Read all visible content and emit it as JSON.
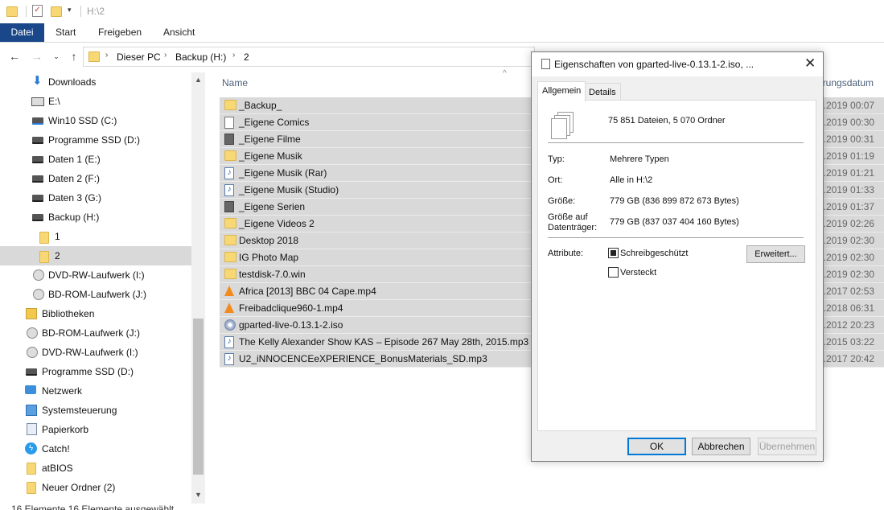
{
  "window": {
    "title_path": "H:\\2"
  },
  "ribbon": {
    "tabs": [
      "Datei",
      "Start",
      "Freigeben",
      "Ansicht"
    ]
  },
  "address": {
    "crumbs": [
      "Dieser PC",
      "Backup (H:)",
      "2"
    ]
  },
  "nav": {
    "items": [
      {
        "label": "Downloads",
        "icon": "download-arrow-icon"
      },
      {
        "label": "E:\\",
        "icon": "drive-icon"
      },
      {
        "label": "Win10 SSD (C:)",
        "icon": "windows-drive-icon"
      },
      {
        "label": "Programme SSD (D:)",
        "icon": "drive-icon"
      },
      {
        "label": "Daten 1 (E:)",
        "icon": "drive-icon"
      },
      {
        "label": "Daten 2 (F:)",
        "icon": "drive-icon"
      },
      {
        "label": "Daten 3 (G:)",
        "icon": "drive-icon"
      },
      {
        "label": "Backup (H:)",
        "icon": "drive-icon"
      },
      {
        "label": "1",
        "icon": "folder-icon"
      },
      {
        "label": "2",
        "icon": "folder-icon"
      },
      {
        "label": "DVD-RW-Laufwerk (I:)",
        "icon": "optical-drive-icon"
      },
      {
        "label": "BD-ROM-Laufwerk (J:)",
        "icon": "optical-drive-icon"
      },
      {
        "label": "Bibliotheken",
        "icon": "libraries-icon"
      },
      {
        "label": "BD-ROM-Laufwerk (J:)",
        "icon": "optical-drive-icon"
      },
      {
        "label": "DVD-RW-Laufwerk (I:)",
        "icon": "optical-drive-icon"
      },
      {
        "label": "Programme SSD (D:)",
        "icon": "drive-icon"
      },
      {
        "label": "Netzwerk",
        "icon": "network-icon"
      },
      {
        "label": "Systemsteuerung",
        "icon": "control-panel-icon"
      },
      {
        "label": "Papierkorb",
        "icon": "recycle-bin-icon"
      },
      {
        "label": "Catch!",
        "icon": "catch-app-icon"
      },
      {
        "label": "atBIOS",
        "icon": "folder-icon"
      },
      {
        "label": "Neuer Ordner (2)",
        "icon": "folder-icon"
      }
    ]
  },
  "list": {
    "header": {
      "name": "Name",
      "date": "erungsdatum"
    },
    "rows": [
      {
        "name": "_Backup_",
        "icon": "folder-icon",
        "date": "2.2019 00:07"
      },
      {
        "name": "_Eigene Comics",
        "icon": "document-icon",
        "date": "2.2019 00:30"
      },
      {
        "name": "_Eigene Filme",
        "icon": "film-icon",
        "date": "2.2019 00:31"
      },
      {
        "name": "_Eigene Musik",
        "icon": "folder-icon",
        "date": "2.2019 01:19"
      },
      {
        "name": "_Eigene Musik (Rar)",
        "icon": "music-icon",
        "date": "2.2019 01:21"
      },
      {
        "name": "_Eigene Musik (Studio)",
        "icon": "music-icon",
        "date": "2.2019 01:33"
      },
      {
        "name": "_Eigene Serien",
        "icon": "film-icon",
        "date": "2.2019 01:37"
      },
      {
        "name": "_Eigene Videos 2",
        "icon": "folder-icon",
        "date": "2.2019 02:26"
      },
      {
        "name": "Desktop 2018",
        "icon": "folder-icon",
        "date": "2.2019 02:30"
      },
      {
        "name": "IG Photo Map",
        "icon": "folder-icon",
        "date": "2.2019 02:30"
      },
      {
        "name": "testdisk-7.0.win",
        "icon": "folder-icon",
        "date": "2.2019 02:30"
      },
      {
        "name": "Africa [2013] BBC 04 Cape.mp4",
        "icon": "vlc-icon",
        "date": "5.2017 02:53"
      },
      {
        "name": "Freibadclique960-1.mp4",
        "icon": "vlc-icon",
        "date": "4.2018 06:31"
      },
      {
        "name": "gparted-live-0.13.1-2.iso",
        "icon": "disc-image-icon",
        "date": "8.2012 20:23"
      },
      {
        "name": "The Kelly Alexander Show KAS – Episode 267 May 28th, 2015.mp3",
        "icon": "music-icon",
        "date": "5.2015 03:22"
      },
      {
        "name": "U2_iNNOCENCEeXPERIENCE_BonusMaterials_SD.mp3",
        "icon": "music-icon",
        "date": "1.2017 20:42"
      }
    ]
  },
  "dialog": {
    "title": "Eigenschaften von gparted-live-0.13.1-2.iso, ...",
    "tabs": [
      "Allgemein",
      "Details"
    ],
    "summary": "75 851 Dateien, 5 070 Ordner",
    "type_label": "Typ:",
    "type_value": "Mehrere Typen",
    "location_label": "Ort:",
    "location_value": "Alle in H:\\2",
    "size_label": "Größe:",
    "size_value": "779 GB (836 899 872 673 Bytes)",
    "disk_label_1": "Größe auf",
    "disk_label_2": "Datenträger:",
    "disk_value": "779 GB (837 037 404 160 Bytes)",
    "attr_label": "Attribute:",
    "readonly_label": "Schreibgeschützt",
    "hidden_label": "Versteckt",
    "advanced_label": "Erweitert...",
    "ok_label": "OK",
    "cancel_label": "Abbrechen",
    "apply_label": "Übernehmen"
  },
  "status": {
    "text": "16 Elemente    16 Elemente ausgewählt"
  }
}
